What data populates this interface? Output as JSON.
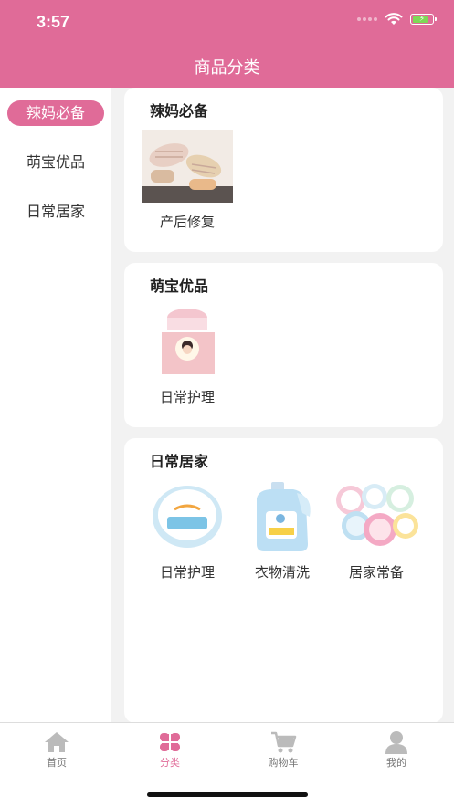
{
  "status": {
    "time": "3:57"
  },
  "header": {
    "title": "商品分类"
  },
  "sidebar": {
    "items": [
      {
        "label": "辣妈必备",
        "active": true
      },
      {
        "label": "萌宝优品",
        "active": false
      },
      {
        "label": "日常居家",
        "active": false
      }
    ]
  },
  "sections": [
    {
      "title": "辣妈必备",
      "products": [
        {
          "label": "产后修复",
          "icon": "slippers-image"
        }
      ]
    },
    {
      "title": "萌宝优品",
      "products": [
        {
          "label": "日常护理",
          "icon": "baby-cream-image"
        }
      ]
    },
    {
      "title": "日常居家",
      "products": [
        {
          "label": "日常护理",
          "icon": "cream-jar-image"
        },
        {
          "label": "衣物清洗",
          "icon": "laundry-detergent-image"
        },
        {
          "label": "居家常备",
          "icon": "cartoon-badges-image"
        }
      ]
    }
  ],
  "tabbar": {
    "items": [
      {
        "label": "首页",
        "icon": "home-icon"
      },
      {
        "label": "分类",
        "icon": "category-icon",
        "active": true
      },
      {
        "label": "购物车",
        "icon": "cart-icon"
      },
      {
        "label": "我的",
        "icon": "profile-icon"
      }
    ]
  },
  "colors": {
    "accent": "#e06b98",
    "header_bg": "#e06b98",
    "page_bg": "#f2f2f2",
    "inactive_tab": "#bbbbbb"
  }
}
